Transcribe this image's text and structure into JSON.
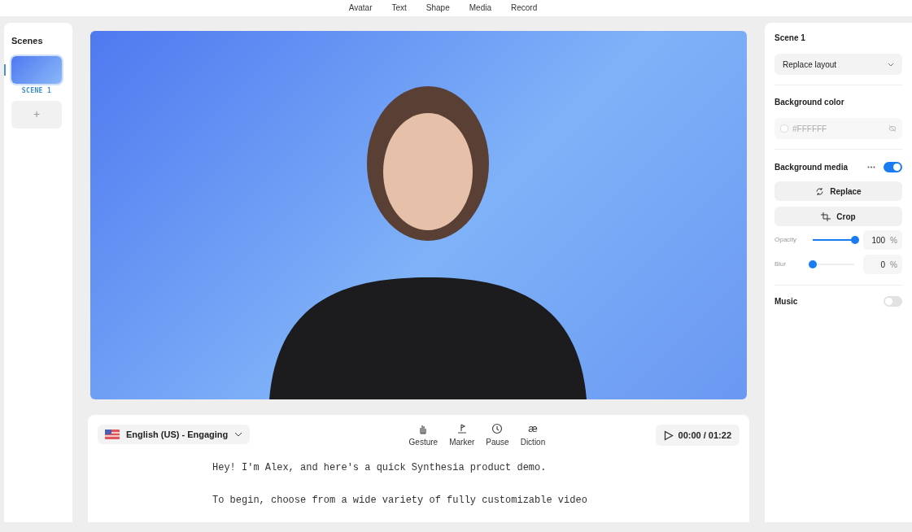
{
  "toolbar": {
    "items": [
      {
        "label": "Avatar"
      },
      {
        "label": "Text"
      },
      {
        "label": "Shape"
      },
      {
        "label": "Media"
      },
      {
        "label": "Record"
      }
    ]
  },
  "scenes_panel": {
    "title": "Scenes",
    "scenes": [
      {
        "label": "SCENE 1",
        "selected": true
      }
    ],
    "add_button": "+"
  },
  "script_panel": {
    "voice": "English (US) - Engaging",
    "tools": [
      {
        "kind": "gesture",
        "label": "Gesture"
      },
      {
        "kind": "marker",
        "label": "Marker"
      },
      {
        "kind": "pause",
        "label": "Pause"
      },
      {
        "kind": "diction",
        "label": "Diction",
        "glyph": "æ"
      }
    ],
    "time": "00:00 / 01:22",
    "lines": [
      "Hey! I'm Alex, and here's a quick Synthesia product demo.",
      "To begin, choose from a wide variety of fully customizable video"
    ]
  },
  "properties": {
    "title": "Scene 1",
    "layout_select": "Replace layout",
    "background_color": {
      "label": "Background color",
      "value": "#FFFFFF"
    },
    "background_media": {
      "label": "Background media",
      "on": true,
      "replace": "Replace",
      "crop": "Crop",
      "sliders": [
        {
          "label": "Opacity",
          "level": 1.0,
          "reading": "100",
          "unit": "%"
        },
        {
          "label": "Blur",
          "level": 0.0,
          "reading": "0",
          "unit": "%"
        }
      ]
    },
    "music": {
      "label": "Music",
      "on": false
    }
  }
}
